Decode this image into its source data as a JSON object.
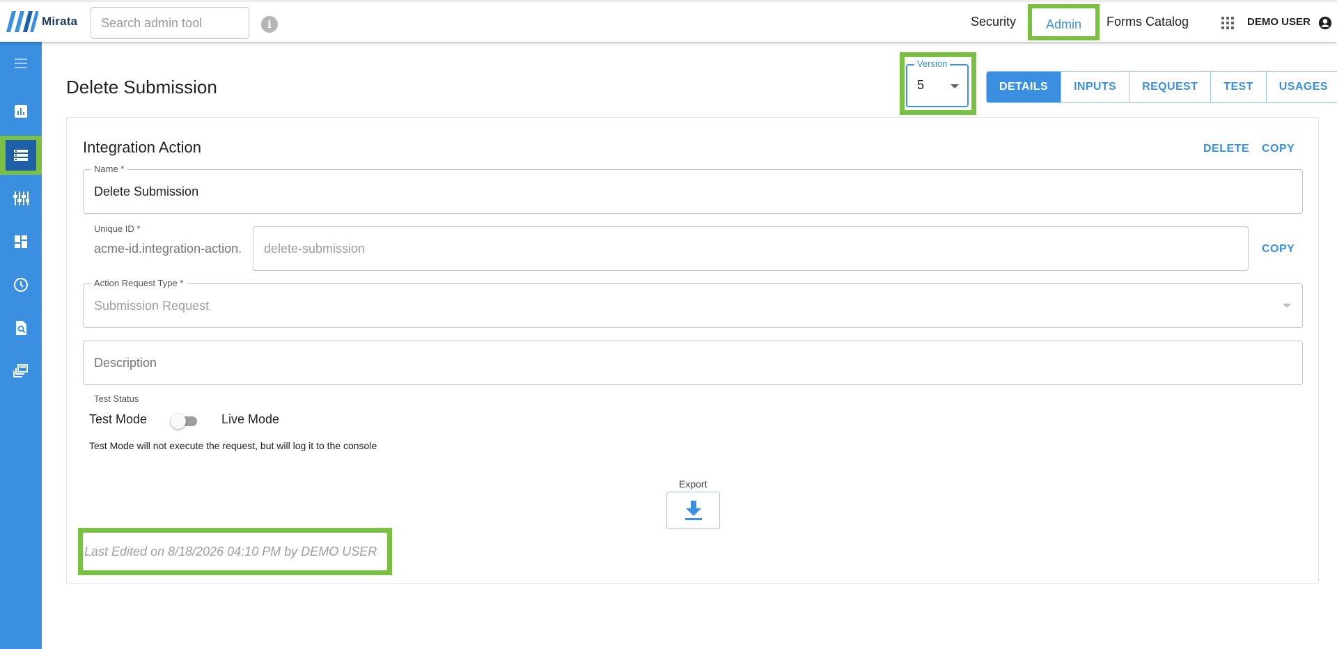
{
  "app": {
    "brand": "Mirata"
  },
  "topbar": {
    "search_placeholder": "Search admin tool",
    "nav": {
      "security": "Security",
      "admin": "Admin",
      "forms_catalog": "Forms Catalog"
    },
    "user_name": "DEMO USER"
  },
  "sidebar": {
    "items": [
      {
        "icon": "menu-icon"
      },
      {
        "icon": "bar-chart-icon"
      },
      {
        "icon": "storage-icon",
        "active": true
      },
      {
        "icon": "tune-icon"
      },
      {
        "icon": "dashboard-icon"
      },
      {
        "icon": "clock-icon"
      },
      {
        "icon": "find-in-page-icon"
      },
      {
        "icon": "library-icon"
      }
    ]
  },
  "page": {
    "title": "Delete Submission",
    "version": {
      "label": "Version",
      "value": "5"
    },
    "tabs": [
      "DETAILS",
      "INPUTS",
      "REQUEST",
      "TEST",
      "USAGES"
    ],
    "active_tab": "DETAILS"
  },
  "card": {
    "title": "Integration Action",
    "delete_label": "DELETE",
    "copy_label": "COPY",
    "name": {
      "label": "Name *",
      "value": "Delete Submission"
    },
    "unique_id": {
      "label": "Unique ID *",
      "prefix": "acme-id.integration-action.",
      "value": "delete-submission",
      "copy_label": "COPY"
    },
    "request_type": {
      "label": "Action Request Type *",
      "value": "Submission Request"
    },
    "description": {
      "placeholder": "Description"
    },
    "test_status": {
      "label": "Test Status",
      "off_label": "Test Mode",
      "on_label": "Live Mode",
      "hint": "Test Mode will not execute the request, but will log it to the console"
    },
    "export_label": "Export",
    "last_edited": "Last Edited on 8/18/2026 04:10 PM by DEMO USER"
  },
  "colors": {
    "accent": "#3a8fe0",
    "highlight": "#7ac043",
    "sidebar": "#3a8fe0"
  }
}
